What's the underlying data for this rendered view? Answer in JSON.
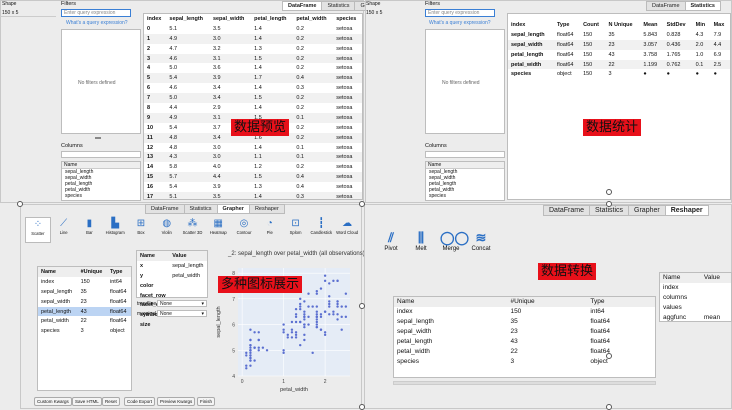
{
  "top_left": {
    "shape_label": "Shape",
    "shape_value": "150 x 5",
    "filters_label": "Filters",
    "query_placeholder": "Enter query expression",
    "query_help": "What's a query expression?",
    "no_filters": "No filters defined",
    "columns_label": "Columns",
    "columns_header": "Name",
    "columns": [
      "sepal_length",
      "sepal_width",
      "petal_length",
      "petal_width",
      "species"
    ],
    "tabs": [
      "DataFrame",
      "Statistics",
      "Grapher"
    ],
    "headers": [
      "index",
      "sepal_length",
      "sepal_width",
      "petal_length",
      "petal_width",
      "species"
    ],
    "rows": [
      [
        "0",
        "5.1",
        "3.5",
        "1.4",
        "0.2",
        "setosa"
      ],
      [
        "1",
        "4.9",
        "3.0",
        "1.4",
        "0.2",
        "setosa"
      ],
      [
        "2",
        "4.7",
        "3.2",
        "1.3",
        "0.2",
        "setosa"
      ],
      [
        "3",
        "4.6",
        "3.1",
        "1.5",
        "0.2",
        "setosa"
      ],
      [
        "4",
        "5.0",
        "3.6",
        "1.4",
        "0.2",
        "setosa"
      ],
      [
        "5",
        "5.4",
        "3.9",
        "1.7",
        "0.4",
        "setosa"
      ],
      [
        "6",
        "4.6",
        "3.4",
        "1.4",
        "0.3",
        "setosa"
      ],
      [
        "7",
        "5.0",
        "3.4",
        "1.5",
        "0.2",
        "setosa"
      ],
      [
        "8",
        "4.4",
        "2.9",
        "1.4",
        "0.2",
        "setosa"
      ],
      [
        "9",
        "4.9",
        "3.1",
        "1.5",
        "0.1",
        "setosa"
      ],
      [
        "10",
        "5.4",
        "3.7",
        "1.5",
        "0.2",
        "setosa"
      ],
      [
        "11",
        "4.8",
        "3.4",
        "1.6",
        "0.2",
        "setosa"
      ],
      [
        "12",
        "4.8",
        "3.0",
        "1.4",
        "0.1",
        "setosa"
      ],
      [
        "13",
        "4.3",
        "3.0",
        "1.1",
        "0.1",
        "setosa"
      ],
      [
        "14",
        "5.8",
        "4.0",
        "1.2",
        "0.2",
        "setosa"
      ],
      [
        "15",
        "5.7",
        "4.4",
        "1.5",
        "0.4",
        "setosa"
      ],
      [
        "16",
        "5.4",
        "3.9",
        "1.3",
        "0.4",
        "setosa"
      ],
      [
        "17",
        "5.1",
        "3.5",
        "1.4",
        "0.3",
        "setosa"
      ]
    ],
    "label": "数据预览"
  },
  "top_right": {
    "shape_label": "Shape",
    "shape_value": "150 x 5",
    "filters_label": "Filters",
    "query_placeholder": "Enter query expression",
    "query_help": "What's a query expression?",
    "no_filters": "No filters defined",
    "columns_label": "Columns",
    "columns_header": "Name",
    "columns": [
      "sepal_length",
      "sepal_width",
      "petal_length",
      "petal_width",
      "species"
    ],
    "tabs": [
      "DataFrame",
      "Statistics"
    ],
    "headers": [
      "index",
      "Type",
      "Count",
      "N Unique",
      "Mean",
      "StdDev",
      "Min",
      "Max"
    ],
    "rows": [
      [
        "sepal_length",
        "float64",
        "150",
        "35",
        "5.843",
        "0.828",
        "4.3",
        "7.9"
      ],
      [
        "sepal_width",
        "float64",
        "150",
        "23",
        "3.057",
        "0.436",
        "2.0",
        "4.4"
      ],
      [
        "petal_length",
        "float64",
        "150",
        "43",
        "3.758",
        "1.765",
        "1.0",
        "6.9"
      ],
      [
        "petal_width",
        "float64",
        "150",
        "22",
        "1.199",
        "0.762",
        "0.1",
        "2.5"
      ],
      [
        "species",
        "object",
        "150",
        "3",
        "●",
        "●",
        "●",
        "●"
      ]
    ],
    "label": "数据统计"
  },
  "bottom_left": {
    "tabs": [
      "DataFrame",
      "Statistics",
      "Grapher",
      "Reshaper"
    ],
    "plot_types": [
      "Scatter",
      "Line",
      "Bar",
      "Histogram",
      "Box",
      "Violin",
      "Scatter 3D",
      "Heatmap",
      "Contour",
      "Pie",
      "Splom",
      "Candlestick",
      "Word Cloud"
    ],
    "var_headers": [
      "Name",
      "#Unique",
      "Type"
    ],
    "vars": [
      [
        "index",
        "150",
        "int64"
      ],
      [
        "sepal_length",
        "35",
        "float64"
      ],
      [
        "sepal_width",
        "23",
        "float64"
      ],
      [
        "petal_length",
        "43",
        "float64"
      ],
      [
        "petal_width",
        "22",
        "float64"
      ],
      [
        "species",
        "3",
        "object"
      ]
    ],
    "field_headers": [
      "Name",
      "Value"
    ],
    "fields": [
      [
        "x",
        "sepal_length"
      ],
      [
        "y",
        "petal_width"
      ],
      [
        "color",
        ""
      ],
      [
        "facet_row",
        ""
      ],
      [
        "facet_col",
        ""
      ],
      [
        "symbol",
        ""
      ],
      [
        "size",
        ""
      ]
    ],
    "trendline_label": "trendline",
    "trendline_value": "None",
    "marginal_label": "marginal",
    "marginal_value": "None",
    "chart_title": "_2:  sepal_length  over  petal_width (all observations)",
    "xlabel": "petal_width",
    "ylabel": "sepal_length",
    "buttons": [
      "Custom Kwargs",
      "Save HTML",
      "Reset",
      "Code Export",
      "Preview Kwargs",
      "Finish"
    ],
    "label": "多种图标展示"
  },
  "bottom_right": {
    "tabs": [
      "DataFrame",
      "Statistics",
      "Grapher",
      "Reshaper"
    ],
    "tools": [
      "Pivot",
      "Melt",
      "Merge",
      "Concat"
    ],
    "var_headers": [
      "Name",
      "#Unique",
      "Type"
    ],
    "vars": [
      [
        "index",
        "150",
        "int64"
      ],
      [
        "sepal_length",
        "35",
        "float64"
      ],
      [
        "sepal_width",
        "23",
        "float64"
      ],
      [
        "petal_length",
        "43",
        "float64"
      ],
      [
        "petal_width",
        "22",
        "float64"
      ],
      [
        "species",
        "3",
        "object"
      ]
    ],
    "param_headers": [
      "Name",
      "Value"
    ],
    "params": [
      [
        "index",
        ""
      ],
      [
        "columns",
        ""
      ],
      [
        "values",
        ""
      ],
      [
        "aggfunc",
        "mean"
      ]
    ],
    "label": "数据转换"
  },
  "chart_data": {
    "type": "scatter",
    "title": "_2:  sepal_length  over  petal_width (all observations)",
    "xlabel": "petal_width",
    "ylabel": "sepal_length",
    "xlim": [
      -0.1,
      2.6
    ],
    "ylim": [
      4,
      8.2
    ],
    "x_ticks": [
      "0",
      "1",
      "2"
    ],
    "y_ticks": [
      "4",
      "5",
      "6",
      "7",
      "8"
    ],
    "points": [
      [
        0.2,
        5.1
      ],
      [
        0.2,
        4.9
      ],
      [
        0.2,
        4.7
      ],
      [
        0.2,
        4.6
      ],
      [
        0.2,
        5.0
      ],
      [
        0.4,
        5.4
      ],
      [
        0.3,
        4.6
      ],
      [
        0.2,
        5.0
      ],
      [
        0.2,
        4.4
      ],
      [
        0.1,
        4.9
      ],
      [
        0.2,
        5.4
      ],
      [
        0.2,
        4.8
      ],
      [
        0.1,
        4.8
      ],
      [
        0.1,
        4.3
      ],
      [
        0.2,
        5.8
      ],
      [
        0.4,
        5.7
      ],
      [
        0.4,
        5.4
      ],
      [
        0.3,
        5.1
      ],
      [
        0.3,
        5.7
      ],
      [
        0.3,
        5.1
      ],
      [
        0.2,
        5.4
      ],
      [
        0.4,
        5.1
      ],
      [
        0.2,
        4.6
      ],
      [
        0.5,
        5.1
      ],
      [
        0.2,
        4.8
      ],
      [
        0.2,
        5.0
      ],
      [
        0.4,
        5.0
      ],
      [
        0.2,
        5.2
      ],
      [
        0.2,
        5.2
      ],
      [
        0.2,
        4.7
      ],
      [
        0.6,
        5.0
      ],
      [
        0.1,
        4.4
      ],
      [
        1.4,
        7.0
      ],
      [
        1.5,
        6.4
      ],
      [
        1.5,
        6.9
      ],
      [
        1.3,
        5.5
      ],
      [
        1.5,
        6.5
      ],
      [
        1.3,
        5.7
      ],
      [
        1.6,
        6.3
      ],
      [
        1.0,
        4.9
      ],
      [
        1.3,
        6.6
      ],
      [
        1.4,
        5.2
      ],
      [
        1.0,
        5.0
      ],
      [
        1.5,
        5.9
      ],
      [
        1.0,
        6.0
      ],
      [
        1.4,
        6.1
      ],
      [
        1.3,
        5.6
      ],
      [
        1.4,
        6.7
      ],
      [
        1.5,
        5.6
      ],
      [
        1.0,
        5.8
      ],
      [
        1.5,
        6.2
      ],
      [
        1.1,
        5.6
      ],
      [
        1.8,
        5.9
      ],
      [
        1.3,
        6.1
      ],
      [
        1.5,
        6.3
      ],
      [
        1.2,
        6.1
      ],
      [
        1.3,
        6.4
      ],
      [
        1.4,
        6.6
      ],
      [
        1.4,
        6.8
      ],
      [
        1.7,
        6.7
      ],
      [
        1.5,
        6.0
      ],
      [
        1.0,
        5.7
      ],
      [
        1.1,
        5.5
      ],
      [
        1.2,
        5.8
      ],
      [
        1.6,
        6.0
      ],
      [
        1.5,
        5.4
      ],
      [
        1.6,
        6.7
      ],
      [
        1.3,
        6.3
      ],
      [
        1.2,
        5.5
      ],
      [
        1.2,
        5.7
      ],
      [
        2.5,
        6.3
      ],
      [
        1.9,
        5.8
      ],
      [
        2.1,
        7.1
      ],
      [
        1.8,
        6.3
      ],
      [
        2.2,
        6.5
      ],
      [
        2.1,
        7.6
      ],
      [
        1.7,
        4.9
      ],
      [
        1.8,
        7.3
      ],
      [
        1.8,
        6.7
      ],
      [
        2.5,
        7.2
      ],
      [
        2.0,
        6.5
      ],
      [
        1.9,
        6.4
      ],
      [
        2.1,
        6.8
      ],
      [
        2.0,
        5.7
      ],
      [
        2.4,
        5.8
      ],
      [
        2.3,
        6.4
      ],
      [
        1.8,
        6.5
      ],
      [
        2.2,
        7.7
      ],
      [
        2.3,
        7.7
      ],
      [
        1.5,
        6.0
      ],
      [
        2.3,
        6.9
      ],
      [
        2.0,
        5.6
      ],
      [
        2.0,
        7.7
      ],
      [
        1.8,
        6.3
      ],
      [
        2.1,
        6.7
      ],
      [
        1.8,
        7.2
      ],
      [
        1.8,
        6.2
      ],
      [
        1.8,
        6.1
      ],
      [
        2.1,
        6.4
      ],
      [
        1.6,
        7.2
      ],
      [
        1.9,
        7.4
      ],
      [
        2.0,
        7.9
      ],
      [
        2.2,
        6.4
      ],
      [
        1.5,
        6.3
      ],
      [
        1.4,
        6.1
      ],
      [
        2.3,
        7.7
      ],
      [
        2.4,
        6.3
      ],
      [
        1.8,
        6.4
      ],
      [
        1.8,
        6.0
      ],
      [
        2.1,
        6.9
      ],
      [
        2.4,
        6.7
      ],
      [
        2.3,
        6.9
      ],
      [
        1.9,
        5.8
      ],
      [
        2.3,
        6.8
      ],
      [
        2.5,
        6.7
      ],
      [
        2.3,
        6.7
      ],
      [
        1.9,
        6.3
      ],
      [
        2.0,
        6.5
      ],
      [
        2.3,
        6.2
      ],
      [
        1.8,
        5.9
      ]
    ]
  },
  "colors": {
    "accent": "#3a7fd5",
    "red_label": "#e8101a",
    "scatter": "#5b6fd0",
    "plot_bg": "#e5ecf6"
  }
}
